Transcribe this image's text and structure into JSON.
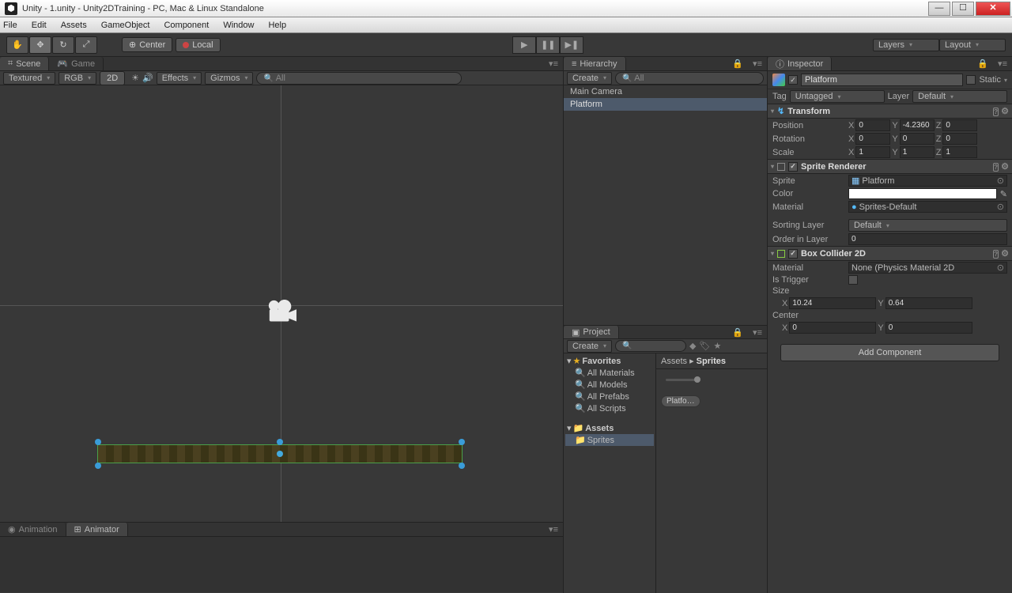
{
  "window": {
    "title": "Unity - 1.unity - Unity2DTraining - PC, Mac & Linux Standalone"
  },
  "menu": [
    "File",
    "Edit",
    "Assets",
    "GameObject",
    "Component",
    "Window",
    "Help"
  ],
  "toolbar": {
    "center": "Center",
    "local": "Local",
    "layers": "Layers",
    "layout": "Layout"
  },
  "scene": {
    "tab": "Scene",
    "game_tab": "Game",
    "shading": "Textured",
    "render": "RGB",
    "mode2d": "2D",
    "effects": "Effects",
    "gizmos": "Gizmos",
    "search_ph": "All"
  },
  "hierarchy": {
    "title": "Hierarchy",
    "create": "Create",
    "search_ph": "All",
    "items": [
      "Main Camera",
      "Platform"
    ],
    "selected": 1
  },
  "project": {
    "title": "Project",
    "create": "Create",
    "favorites": "Favorites",
    "fav_items": [
      "All Materials",
      "All Models",
      "All Prefabs",
      "All Scripts"
    ],
    "assets": "Assets",
    "sub": [
      "Sprites"
    ],
    "breadcrumb": {
      "root": "Assets",
      "sep": "▸",
      "leaf": "Sprites"
    },
    "asset_name": "Platfo…"
  },
  "inspector": {
    "title": "Inspector",
    "name": "Platform",
    "static": "Static",
    "tag_lbl": "Tag",
    "tag": "Untagged",
    "layer_lbl": "Layer",
    "layer": "Default",
    "transform": {
      "title": "Transform",
      "pos": "Position",
      "rot": "Rotation",
      "scl": "Scale",
      "p": {
        "x": "0",
        "y": "-4.2360",
        "z": "0"
      },
      "r": {
        "x": "0",
        "y": "0",
        "z": "0"
      },
      "s": {
        "x": "1",
        "y": "1",
        "z": "1"
      }
    },
    "sprite_renderer": {
      "title": "Sprite Renderer",
      "sprite_lbl": "Sprite",
      "sprite": "Platform",
      "color_lbl": "Color",
      "material_lbl": "Material",
      "material": "Sprites-Default",
      "sorting_lbl": "Sorting Layer",
      "sorting": "Default",
      "order_lbl": "Order in Layer",
      "order": "0"
    },
    "box_collider": {
      "title": "Box Collider 2D",
      "material_lbl": "Material",
      "material": "None (Physics Material 2D",
      "trigger_lbl": "Is Trigger",
      "size_lbl": "Size",
      "sx": "10.24",
      "sy": "0.64",
      "center_lbl": "Center",
      "cx": "0",
      "cy": "0"
    },
    "add": "Add Component"
  },
  "bottom": {
    "anim": "Animation",
    "animator": "Animator"
  }
}
